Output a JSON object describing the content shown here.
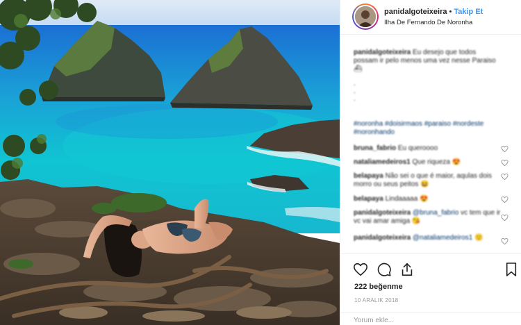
{
  "header": {
    "username": "panidalgoteixeira",
    "separator": "•",
    "follow_label": "Takip Et",
    "location": "Ilha De Fernando De Noronha"
  },
  "caption": {
    "username": "panidalgoteixeira",
    "text": "Eu desejo que todos possam ir pelo menos uma vez nesse Paraiso",
    "dots": [
      ".",
      ".",
      "."
    ],
    "hashtags": "#noronha #doisirmaos #paraiso #nordeste #noronhando"
  },
  "comments": [
    {
      "user": "bruna_fabrio",
      "text": "Eu queroooo",
      "mention": ""
    },
    {
      "user": "nataliamedeiros1",
      "text": "Que riqueza",
      "mention": ""
    },
    {
      "user": "belapaya",
      "text": "Não sei o que é maior, aqulas dois morro ou seus peitos",
      "mention": ""
    },
    {
      "user": "belapaya",
      "text": "Lindaaaaa",
      "mention": ""
    },
    {
      "user": "panidalgoteixeira",
      "text": "vc tem que ir vc vai amar amiga",
      "mention": "@bruna_fabrio"
    },
    {
      "user": "panidalgoteixeira",
      "text": "",
      "mention": "@nataliamedeiros1"
    }
  ],
  "actions": {
    "icons": [
      "heart-icon",
      "comment-icon",
      "share-icon",
      "bookmark-icon"
    ],
    "likes": "222 beğenme",
    "date": "10 ARALIK 2018"
  },
  "add_comment": {
    "placeholder": "Yorum ekle..."
  },
  "colors": {
    "link_blue": "#3897f0",
    "hashtag_blue": "#003569",
    "text": "#262626",
    "muted": "#999999"
  }
}
